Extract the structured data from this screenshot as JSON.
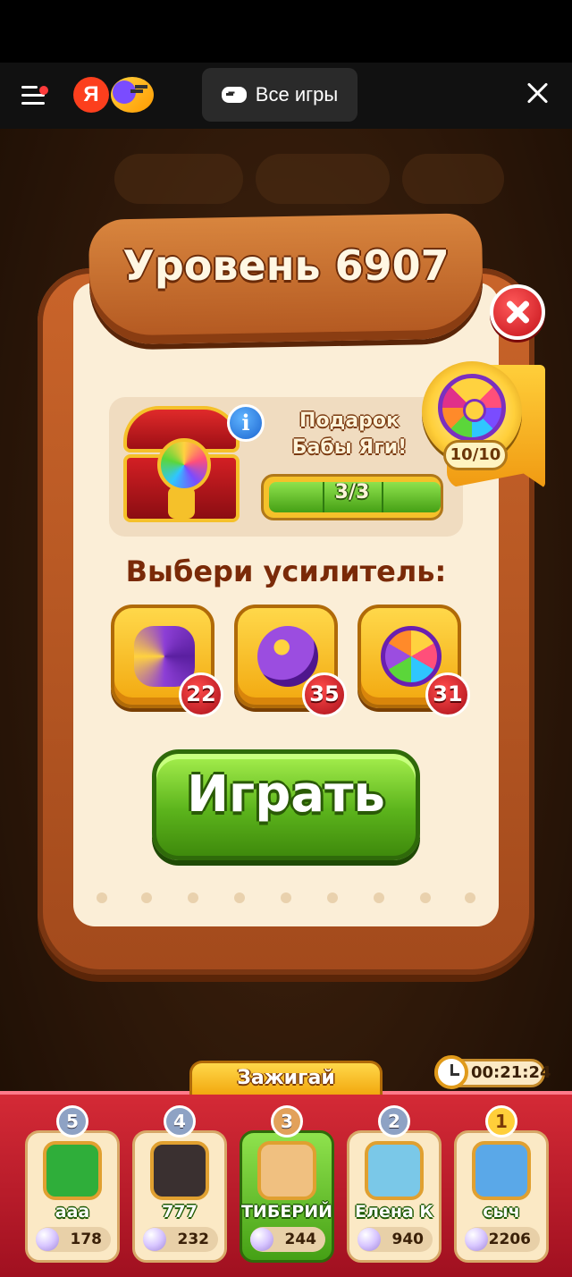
{
  "browser": {
    "all_games_label": "Все игры",
    "ya_logo": "Я"
  },
  "icons": {
    "menu": "hamburger-menu-icon",
    "yandex": "yandex-logo-icon",
    "games": "yandex-games-icon",
    "gamepad": "gamepad-icon",
    "close": "close-icon",
    "info": "info-icon",
    "clock": "clock-icon",
    "pearl": "pearl-icon"
  },
  "level": {
    "title": "Уровень 6907"
  },
  "gift": {
    "title": "Подарок Бабы Яги!",
    "progress_label": "3/3",
    "progress": 1.0,
    "info_glyph": "i"
  },
  "wheel": {
    "count_label": "10/10"
  },
  "boosters": {
    "title": "Выбери усилитель:",
    "items": [
      {
        "name": "hammer-booster",
        "count": "22"
      },
      {
        "name": "bomb-booster",
        "count": "35"
      },
      {
        "name": "spinner-booster",
        "count": "31"
      }
    ]
  },
  "play_button": {
    "label": "Играть"
  },
  "tournament": {
    "tab_label": "Зажигай",
    "timer": "00:21:24",
    "players": [
      {
        "rank": "5",
        "name": "aaa",
        "score": "178",
        "avatar_color": "#2fae3a"
      },
      {
        "rank": "4",
        "name": "777",
        "score": "232",
        "avatar_color": "#3a3030"
      },
      {
        "rank": "3",
        "name": "ТИБЕРИЙ",
        "score": "244",
        "avatar_color": "#f0c080",
        "me": true
      },
      {
        "rank": "2",
        "name": "Елена К",
        "score": "940",
        "avatar_color": "#7ac8e8"
      },
      {
        "rank": "1",
        "name": "сыч",
        "score": "2206",
        "avatar_color": "#5aa8e8"
      }
    ]
  },
  "colors": {
    "accent_green": "#5cb41c",
    "accent_red": "#c4121a",
    "wood": "#b25720",
    "paper": "#fbeed7"
  }
}
